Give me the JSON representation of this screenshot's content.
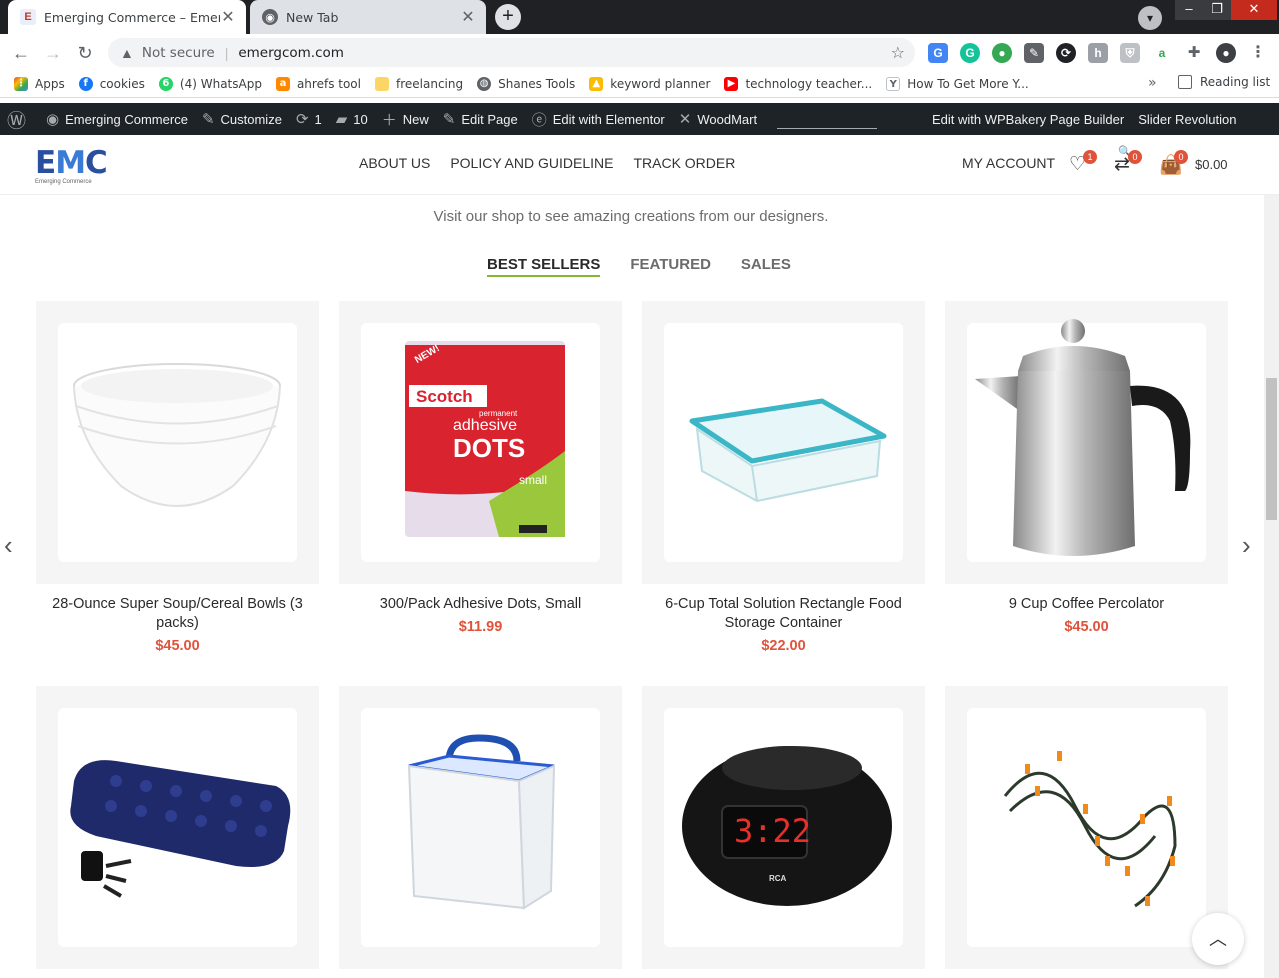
{
  "browser": {
    "tabs": [
      {
        "title": "Emerging Commerce – Emerging",
        "active": true,
        "icon": "emc-favicon"
      },
      {
        "title": "New Tab",
        "active": false,
        "icon": "chrome-icon"
      }
    ],
    "new_tab_label": "+",
    "address": {
      "security_label": "Not secure",
      "url": "emergcom.com"
    },
    "bookmarks": [
      {
        "label": "Apps",
        "icon": "apps-grid-icon",
        "color": "#4285f4"
      },
      {
        "label": "cookies",
        "icon": "facebook-icon",
        "color": "#1877f2"
      },
      {
        "label": "(4) WhatsApp",
        "icon": "whatsapp-icon",
        "color": "#25d366"
      },
      {
        "label": "ahrefs tool",
        "icon": "ahrefs-icon",
        "color": "#ff8800"
      },
      {
        "label": "freelancing",
        "icon": "folder-icon",
        "color": "#fcd664"
      },
      {
        "label": "Shanes Tools",
        "icon": "globe-icon",
        "color": "#5f6368"
      },
      {
        "label": "keyword planner",
        "icon": "google-ads-icon",
        "color": "#fbbc04"
      },
      {
        "label": "technology teacher...",
        "icon": "youtube-icon",
        "color": "#ff0000"
      },
      {
        "label": "How To Get More Y...",
        "icon": "yoast-icon",
        "color": "#a4286a"
      }
    ],
    "bookmarks_more": "»",
    "reading_list": "Reading list"
  },
  "adminbar": {
    "site_name": "Emerging Commerce",
    "customize": "Customize",
    "updates_count": "1",
    "comments_count": "10",
    "new_label": "New",
    "edit_page": "Edit Page",
    "edit_elementor": "Edit with Elementor",
    "woodmart": "WoodMart",
    "wpbakery": "Edit with WPBakery Page Builder",
    "slider": "Slider Revolution"
  },
  "header": {
    "logo_text": "EMC",
    "logo_sub": "Emerging Commerce",
    "nav": [
      "ABOUT US",
      "POLICY AND GUIDELINE",
      "TRACK ORDER"
    ],
    "account": "MY ACCOUNT",
    "wishlist_count": "1",
    "compare_count": "0",
    "cart_count": "0",
    "cart_total": "$0.00"
  },
  "section": {
    "subtitle": "Visit our shop to see amazing creations from our designers.",
    "tabs": [
      "BEST SELLERS",
      "FEATURED",
      "SALES"
    ],
    "active_tab": "BEST SELLERS"
  },
  "products": [
    {
      "name": "28-Ounce Super Soup/Cereal Bowls (3 packs)",
      "price": "$45.00",
      "image": "bowls"
    },
    {
      "name": "300/Pack Adhesive Dots, Small",
      "price": "$11.99",
      "image": "adhesive-dots"
    },
    {
      "name": "6-Cup Total Solution Rectangle Food Storage Container",
      "price": "$22.00",
      "image": "food-container"
    },
    {
      "name": "9 Cup Coffee Percolator",
      "price": "$45.00",
      "image": "percolator"
    },
    {
      "name": "",
      "price": "",
      "image": "air-mattress"
    },
    {
      "name": "",
      "price": "",
      "image": "storage-box"
    },
    {
      "name": "",
      "price": "",
      "image": "clock-radio"
    },
    {
      "name": "",
      "price": "",
      "image": "string-lights"
    }
  ],
  "product_images": {
    "scotch_brand": "Scotch",
    "scotch_line1": "permanent",
    "scotch_line2": "adhesive",
    "scotch_line3": "DOTS",
    "scotch_badge": "NEW!",
    "scotch_size": "small",
    "clock_time": "3:22",
    "clock_brand": "RCA"
  },
  "colors": {
    "accent_green": "#83b735",
    "price_red": "#e0533a",
    "adminbar_bg": "#1d2327"
  }
}
